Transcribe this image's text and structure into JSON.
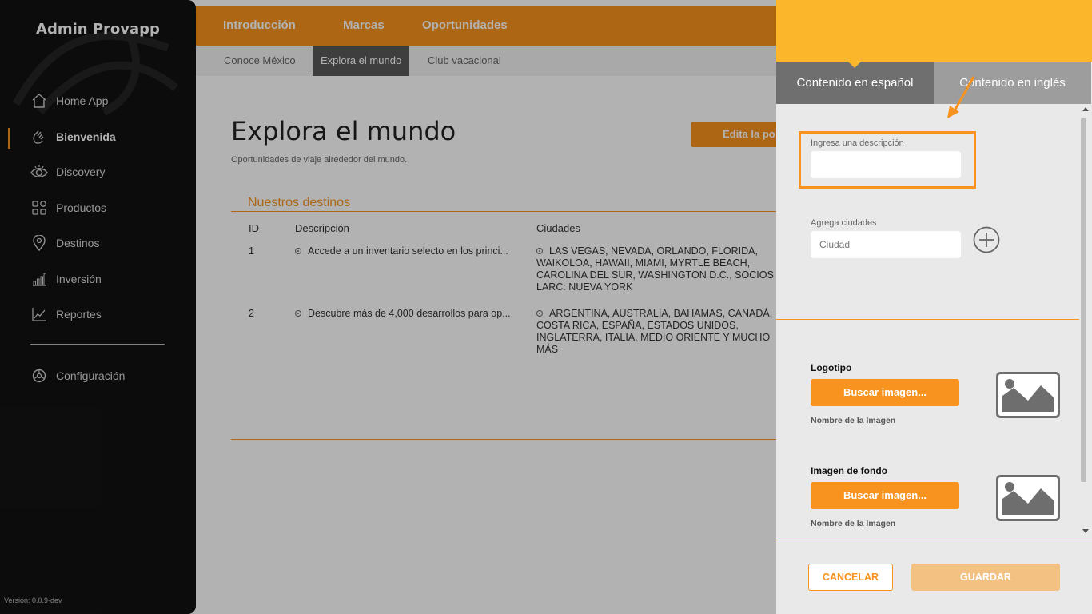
{
  "sidebar": {
    "brand": "Admin Provapp",
    "items": [
      {
        "label": "Home App",
        "icon": "home-icon"
      },
      {
        "label": "Bienvenida",
        "icon": "waving-hand-icon",
        "active": true
      },
      {
        "label": "Discovery",
        "icon": "eye-icon"
      },
      {
        "label": "Productos",
        "icon": "grid-icon"
      },
      {
        "label": "Destinos",
        "icon": "map-pin-icon"
      },
      {
        "label": "Inversión",
        "icon": "bar-chart-icon"
      },
      {
        "label": "Reportes",
        "icon": "line-chart-icon"
      },
      {
        "label": "Configuración",
        "icon": "settings-icon"
      }
    ],
    "version": "Versión: 0.0.9-dev"
  },
  "topnav": {
    "tabs": [
      "Introducción",
      "Marcas",
      "Oportunidades"
    ],
    "active": "Oportunidades"
  },
  "subnav": {
    "tabs": [
      "Conoce México",
      "Explora el mundo",
      "Club vacacional"
    ],
    "active": "Explora el mundo"
  },
  "page": {
    "title": "Explora el mundo",
    "subtitle": "Oportunidades de viaje alrededor del mundo.",
    "edit_button": "Edita la po"
  },
  "destinations": {
    "section_title": "Nuestros destinos",
    "columns": [
      "ID",
      "Descripción",
      "Ciudades"
    ],
    "rows": [
      {
        "id": "1",
        "description": "Accede a un inventario selecto en los princi...",
        "cities": [
          "LAS VEGAS, NEVADA, ORLANDO, FLORIDA,",
          "WAIKOLOA, HAWAII, MIAMI, MYRTLE BEACH,",
          "CAROLINA DEL SUR, WASHINGTON D.C., SOCIOS",
          "LARC: NUEVA YORK"
        ]
      },
      {
        "id": "2",
        "description": "Descubre más de 4,000 desarrollos para op...",
        "cities": [
          "ARGENTINA, AUSTRALIA, BAHAMAS, CANADÁ,",
          "COSTA RICA, ESPAÑA, ESTADOS UNIDOS,",
          "INGLATERRA, ITALIA, MEDIO ORIENTE Y MUCHO",
          "MÁS"
        ]
      }
    ]
  },
  "panel": {
    "tabs": [
      "Contenido en español",
      "Contenido en inglés"
    ],
    "active_tab": "Contenido en español",
    "description_label": "Ingresa una descripción",
    "description_value": "",
    "cities_label": "Agrega ciudades",
    "city_placeholder": "Ciudad",
    "logo": {
      "label": "Logotipo",
      "button": "Buscar imagen...",
      "image_name": "Nombre de la Imagen"
    },
    "background": {
      "label": "Imagen de fondo",
      "button": "Buscar imagen...",
      "image_name": "Nombre de la Imagen"
    },
    "cancel": "CANCELAR",
    "save": "GUARDAR"
  },
  "colors": {
    "accent": "#f7931e",
    "panel_header": "#fbb62b",
    "sidebar_bg": "#121212"
  }
}
